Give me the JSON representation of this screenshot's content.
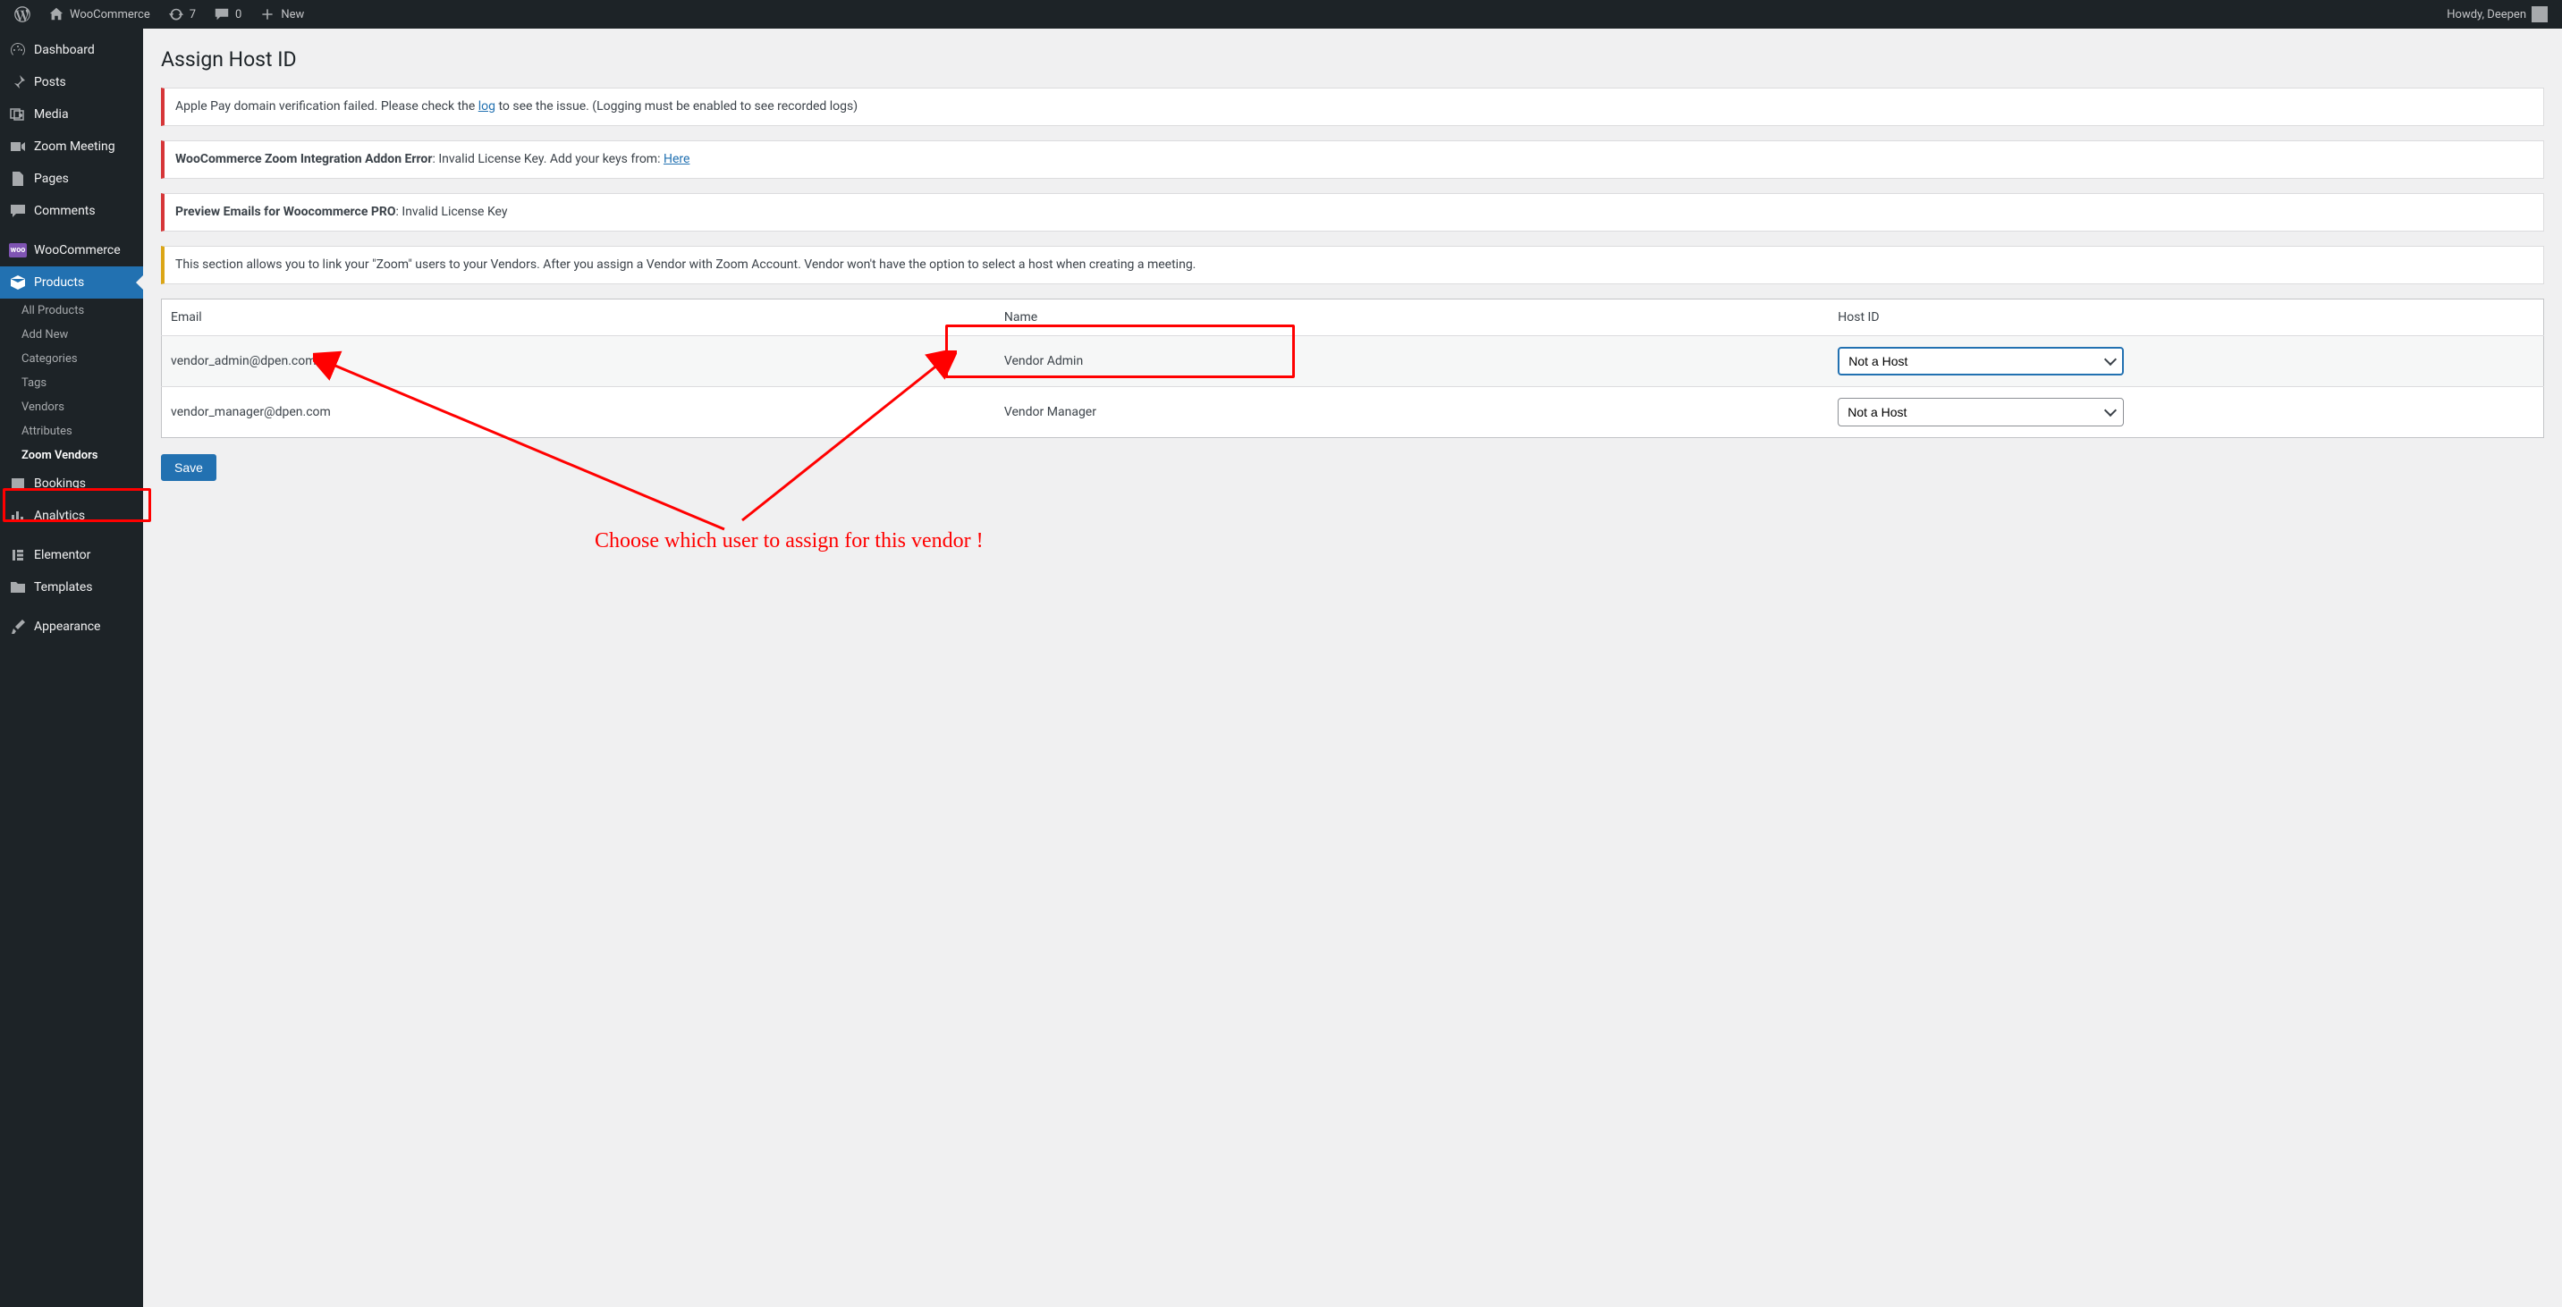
{
  "adminbar": {
    "site_name": "WooCommerce",
    "updates": "7",
    "comments": "0",
    "new": "New",
    "greeting": "Howdy, Deepen"
  },
  "sidebar": {
    "dashboard": "Dashboard",
    "posts": "Posts",
    "media": "Media",
    "zoom_meeting": "Zoom Meeting",
    "pages": "Pages",
    "comments": "Comments",
    "woocommerce": "WooCommerce",
    "products": "Products",
    "sub": {
      "all_products": "All Products",
      "add_new": "Add New",
      "categories": "Categories",
      "tags": "Tags",
      "vendors": "Vendors",
      "attributes": "Attributes",
      "zoom_vendors": "Zoom Vendors"
    },
    "bookings": "Bookings",
    "analytics": "Analytics",
    "elementor": "Elementor",
    "templates": "Templates",
    "appearance": "Appearance"
  },
  "page_title": "Assign Host ID",
  "notices": {
    "n1_prefix": "Apple Pay domain verification failed. Please check the ",
    "n1_link": "log",
    "n1_suffix": " to see the issue. (Logging must be enabled to see recorded logs)",
    "n2_bold": "WooCommerce Zoom Integration Addon Error",
    "n2_text": ": Invalid License Key. Add your keys from: ",
    "n2_link": "Here",
    "n3_bold": "Preview Emails for Woocommerce PRO",
    "n3_text": ": Invalid License Key",
    "n4": "This section allows you to link your \"Zoom\" users to your Vendors. After you assign a Vendor with Zoom Account. Vendor won't have the option to select a host when creating a meeting."
  },
  "table": {
    "headers": {
      "email": "Email",
      "name": "Name",
      "host_id": "Host ID"
    },
    "rows": [
      {
        "email": "vendor_admin@dpen.com",
        "name": "Vendor Admin",
        "host": "Not a Host"
      },
      {
        "email": "vendor_manager@dpen.com",
        "name": "Vendor Manager",
        "host": "Not a Host"
      }
    ]
  },
  "buttons": {
    "save": "Save"
  },
  "annotation": "Choose which user to assign for this vendor !"
}
